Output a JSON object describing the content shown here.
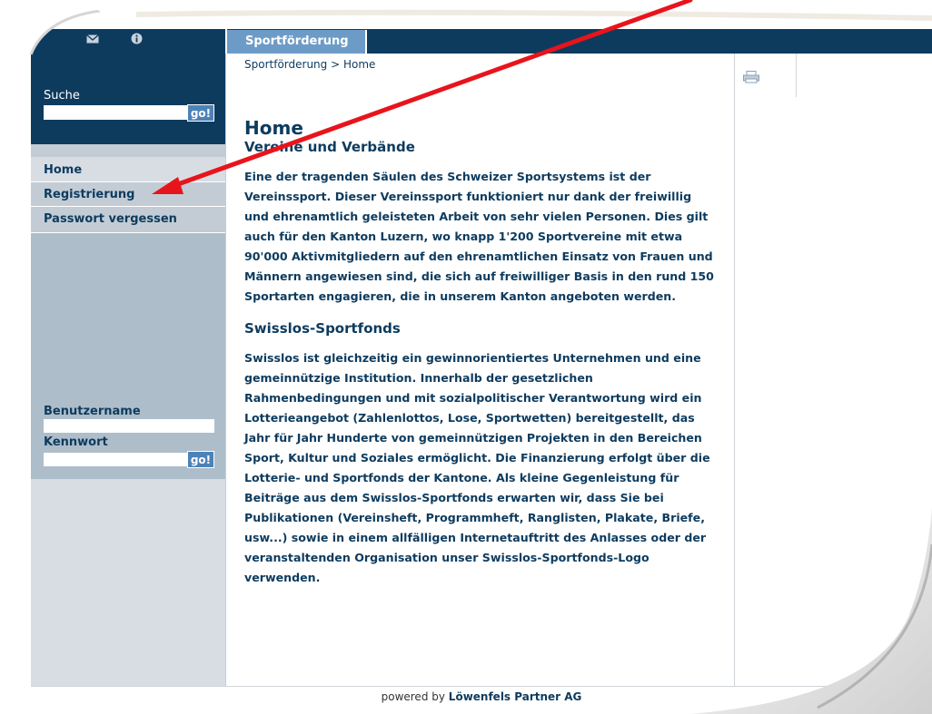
{
  "header": {
    "tab_label": "Sportförderung",
    "icons": [
      "mail-icon",
      "info-icon"
    ]
  },
  "breadcrumb": "Sportförderung > Home",
  "sidebar": {
    "search_label": "Suche",
    "search_go": "go!",
    "nav_items": [
      "Home",
      "Registrierung",
      "Passwort vergessen"
    ],
    "username_label": "Benutzername",
    "password_label": "Kennwort",
    "login_go": "go!"
  },
  "main": {
    "title": "Home",
    "heading1": "Vereine und Verbände",
    "para1": "Eine der tragenden Säulen des Schweizer Sportsystems ist der Vereinssport. Dieser Vereinssport funktioniert nur dank der freiwillig und ehrenamtlich geleisteten Arbeit von sehr vielen Personen. Dies gilt auch für den Kanton Luzern, wo knapp 1'200 Sportvereine mit etwa 90'000 Aktivmitgliedern auf den ehrenamtlichen Einsatz von Frauen und Männern angewiesen sind, die sich auf freiwilliger Basis in den rund 150 Sportarten engagieren, die in unserem Kanton angeboten werden.",
    "heading2": "Swisslos-Sportfonds",
    "para2": "Swisslos ist gleichzeitig ein gewinnorientiertes Unternehmen und eine gemeinnützige Institution. Innerhalb der gesetzlichen Rahmenbedingungen und mit sozialpolitischer Verantwortung wird ein Lotterieangebot (Zahlenlottos, Lose, Sportwetten) bereitgestellt, das Jahr für Jahr Hunderte von gemeinnützigen Projekten in den Bereichen Sport, Kultur und Soziales ermöglicht. Die Finanzierung erfolgt über die Lotterie- und Sportfonds der Kantone. Als kleine Gegenleistung für Beiträge aus dem Swisslos-Sportfonds erwarten wir, dass Sie bei Publikationen (Vereinsheft, Programmheft, Ranglisten, Plakate, Briefe, usw...) sowie in einem allfälligen Internetauftritt des Anlasses oder der veranstaltenden Organisation unser Swisslos-Sportfonds-Logo verwenden."
  },
  "right": {
    "print_icon": "print-icon"
  },
  "footer": {
    "prefix": "powered by",
    "company": "Löwenfels Partner AG"
  },
  "colors": {
    "navy": "#0d3b5e",
    "tab_blue": "#6d9bc7",
    "button_blue": "#4d82b8",
    "sidebar_gray": "#aebdca",
    "arrow_red": "#e8141c"
  }
}
